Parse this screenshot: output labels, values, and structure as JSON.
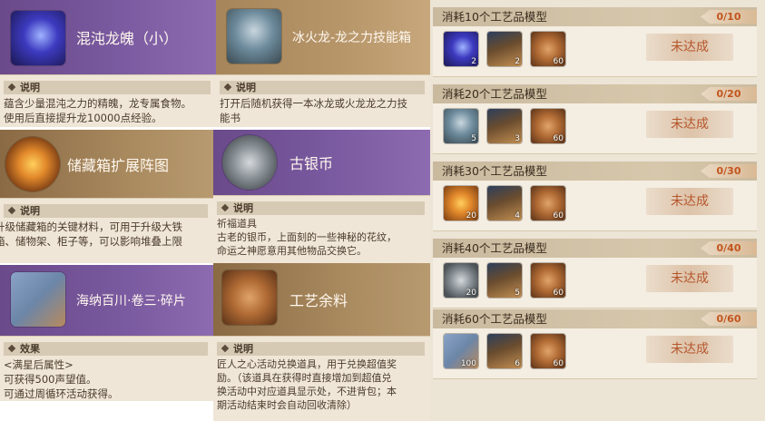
{
  "cards": [
    {
      "title": "混沌龙魄（小）",
      "section": "说明",
      "desc": "蕴含少量混沌之力的精魄，龙专属食物。\n使用后直接提升龙10000点经验。",
      "icon": "purple-crystal-icon"
    },
    {
      "title": "冰火龙-龙之力技能箱",
      "section": "说明",
      "desc": "打开后随机获得一本冰龙或火龙龙之力技\n能书",
      "icon": "treasure-chest-icon"
    },
    {
      "title": "储藏箱扩展阵图",
      "section": "说明",
      "desc": "升级储藏箱的关键材料，可用于升级大铁\n箱、储物架、柜子等，可以影响堆叠上限",
      "icon": "sun-chest-icon"
    },
    {
      "title": "古银币",
      "section": "说明",
      "desc": "祈福道具\n古老的银币，上面刻的一些神秘的花纹，\n命运之神愿意用其他物品交换它。",
      "icon": "silver-coin-icon"
    },
    {
      "title": "海纳百川·卷三·碎片",
      "section": "效果",
      "desc": "<满星后属性>\n可获得500声望值。\n可通过周循环活动获得。",
      "icon": "map-fragment-icon"
    },
    {
      "title": "工艺余料",
      "section": "说明",
      "desc": "匠人之心活动兑换道具，用于兑换超值奖\n励。（该道具在获得时直接增加到超值兑\n换活动中对应道具显示处，不进背包；本\n期活动结束时会自动回收清除）",
      "icon": "leather-scrap-icon"
    }
  ],
  "quests": [
    {
      "title": "消耗10个工艺品模型",
      "progress": "0/10",
      "button": "未达成",
      "items": [
        {
          "icon": "purple-crystal-icon",
          "count": "2"
        },
        {
          "icon": "tree-trunk-icon",
          "count": "2"
        },
        {
          "icon": "leather-scrap-icon",
          "count": "60"
        }
      ]
    },
    {
      "title": "消耗20个工艺品模型",
      "progress": "0/20",
      "button": "未达成",
      "items": [
        {
          "icon": "treasure-chest-icon",
          "count": "5"
        },
        {
          "icon": "tree-trunk-icon",
          "count": "3"
        },
        {
          "icon": "leather-scrap-icon",
          "count": "60"
        }
      ]
    },
    {
      "title": "消耗30个工艺品模型",
      "progress": "0/30",
      "button": "未达成",
      "items": [
        {
          "icon": "sun-chest-icon",
          "count": "20"
        },
        {
          "icon": "tree-trunk-icon",
          "count": "4"
        },
        {
          "icon": "leather-scrap-icon",
          "count": "60"
        }
      ]
    },
    {
      "title": "消耗40个工艺品模型",
      "progress": "0/40",
      "button": "未达成",
      "items": [
        {
          "icon": "silver-coin-icon",
          "count": "20"
        },
        {
          "icon": "tree-trunk-icon",
          "count": "5"
        },
        {
          "icon": "leather-scrap-icon",
          "count": "60"
        }
      ]
    },
    {
      "title": "消耗60个工艺品模型",
      "progress": "0/60",
      "button": "未达成",
      "items": [
        {
          "icon": "map-fragment-icon",
          "count": "100"
        },
        {
          "icon": "tree-trunk-icon",
          "count": "6"
        },
        {
          "icon": "leather-scrap-icon",
          "count": "60"
        }
      ]
    }
  ],
  "colors": {
    "purple_header": "#7a5aa0",
    "gold_header": "#b7966a",
    "progress_text": "#c2551e",
    "button_text": "#b6562c"
  }
}
